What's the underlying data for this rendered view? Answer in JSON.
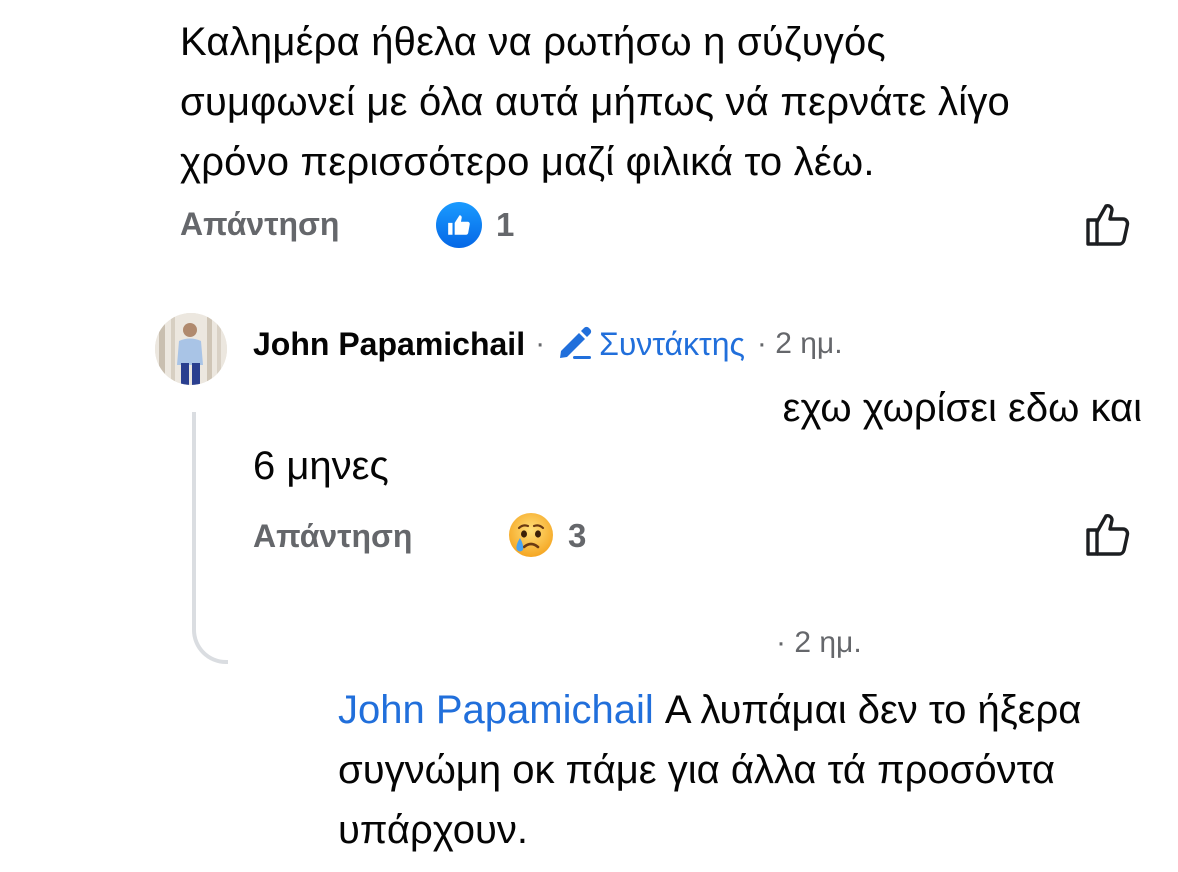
{
  "comment_1": {
    "text": "Καλημέρα ήθελα να ρωτήσω η σύζυγός\nσυμφωνεί με όλα αυτά μήπως νά περνάτε λίγο\nχρόνο περισσότερο μαζί φιλικά το λέω.",
    "reply_label": "Απάντηση",
    "reaction_icon": "like-icon",
    "reaction_count": "1"
  },
  "comment_2": {
    "author": "John Papamichail",
    "separator": "·",
    "role_label": "Συντάκτης",
    "time": "· 2 ημ.",
    "text_line1": "εχω χωρίσει εδω και",
    "text_line2": "6 μηνες",
    "reply_label": "Απάντηση",
    "reaction_icon": "crying-face-icon",
    "reaction_count": "3"
  },
  "comment_3": {
    "time": "· 2 ημ.",
    "mention": "John Papamichail",
    "text": " Α λυπάμαι δεν το ήξερα συγνώμη οκ πάμε για άλλα τά προσόντα υπάρχουν."
  },
  "colors": {
    "link_blue": "#216fdb",
    "secondary_text": "#65676b",
    "like_blue": "#0a7cff"
  }
}
